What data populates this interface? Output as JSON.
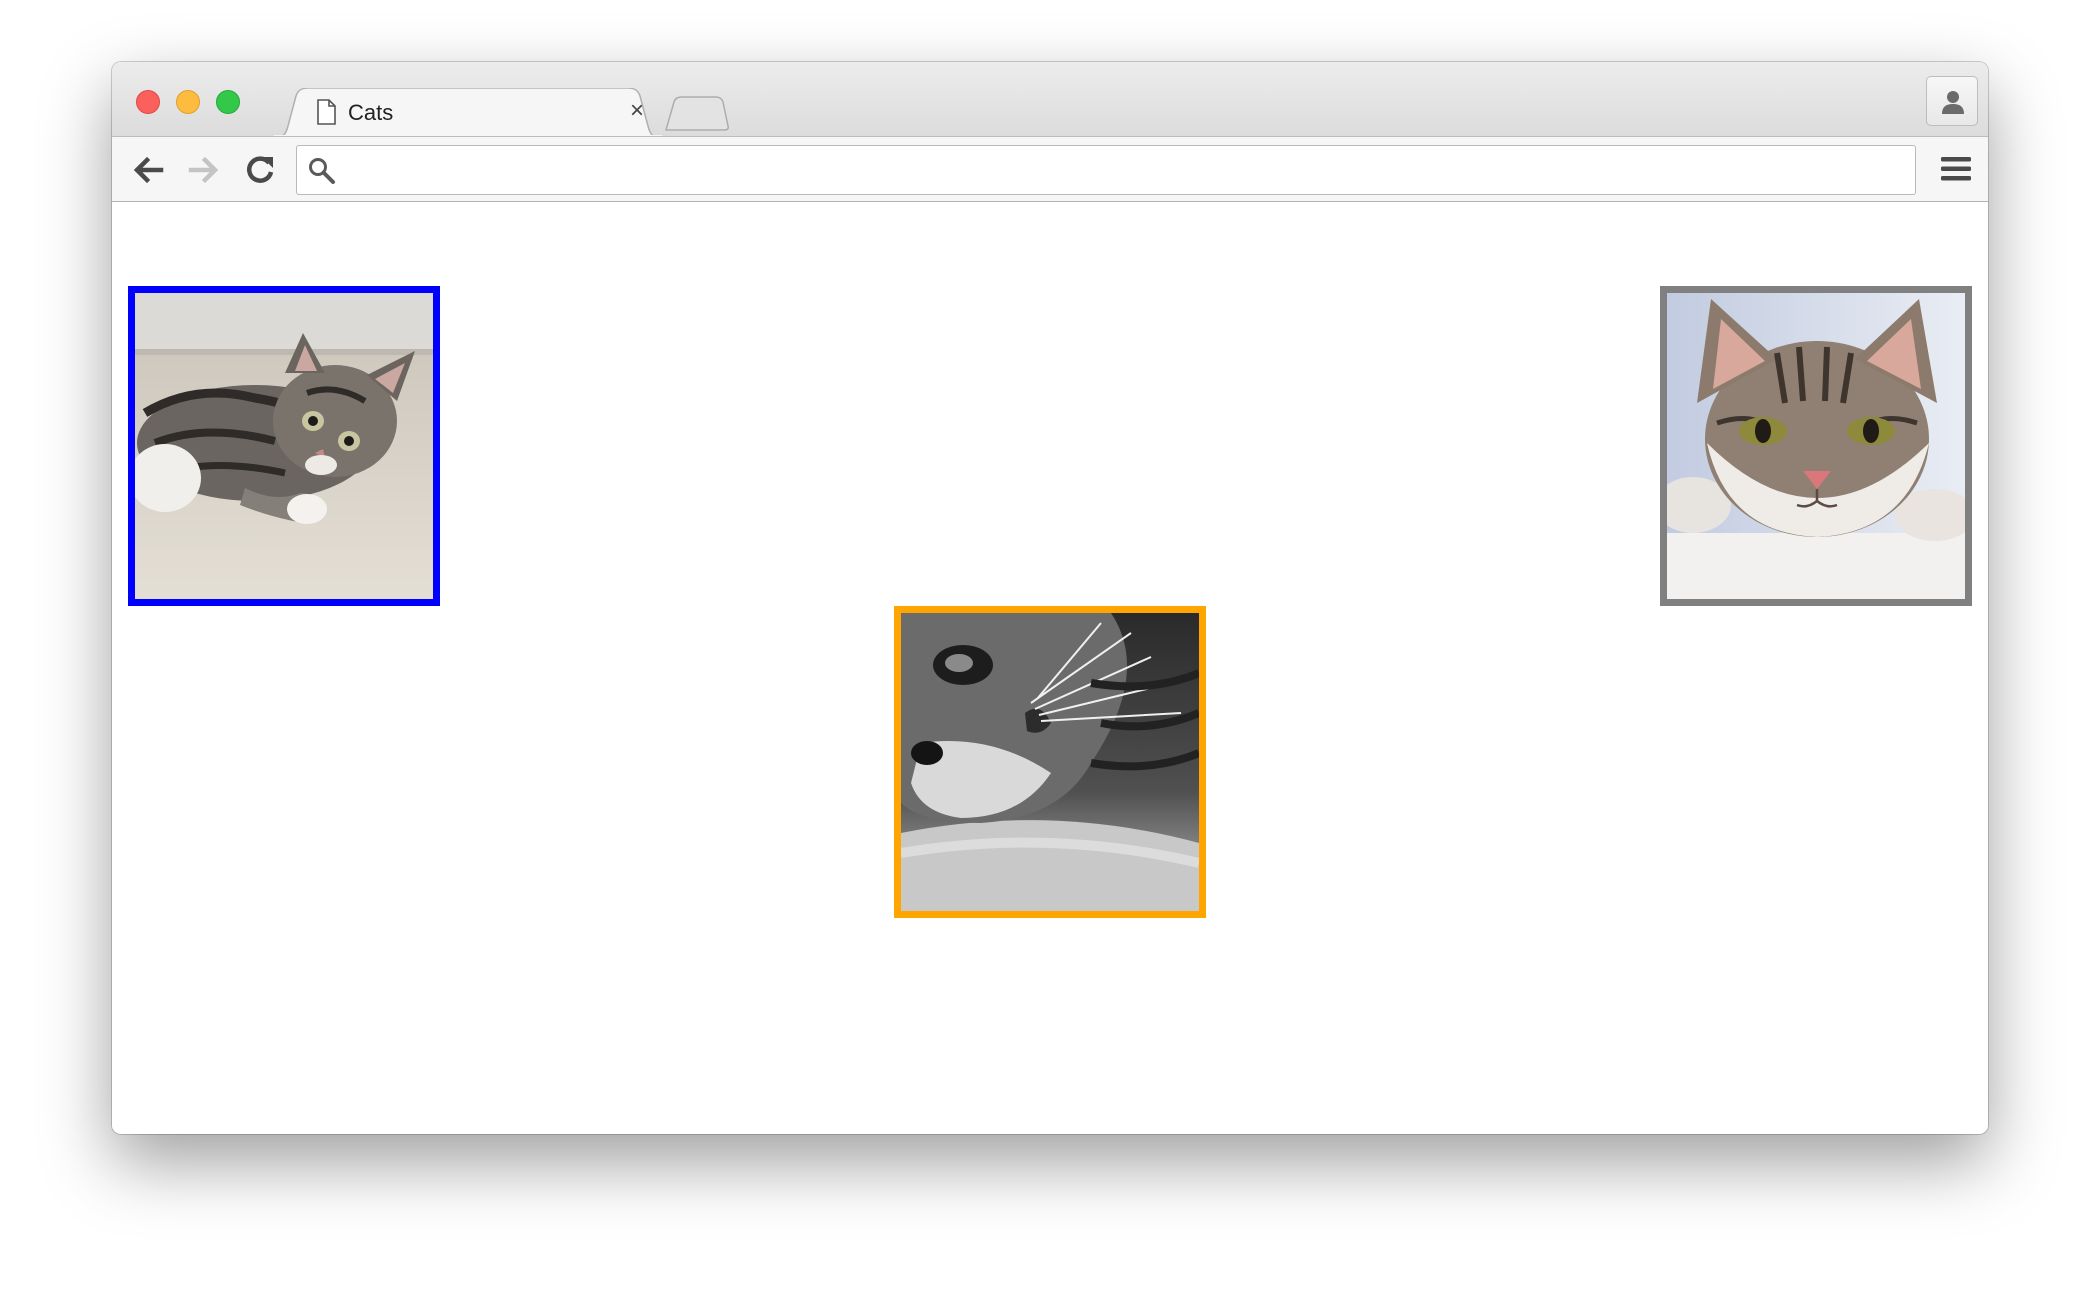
{
  "browser": {
    "tab": {
      "title": "Cats",
      "close_glyph": "×"
    },
    "omnibox": {
      "value": "",
      "placeholder": ""
    },
    "icons": {
      "back": "back-arrow-icon",
      "forward": "forward-arrow-icon",
      "reload": "reload-icon",
      "search": "search-icon",
      "menu": "hamburger-menu-icon",
      "profile": "person-icon",
      "tab_page": "document-icon"
    }
  },
  "page": {
    "images": [
      {
        "name": "cat-image-lying-kitten",
        "border_color": "#0000ff"
      },
      {
        "name": "cat-image-tabby-face",
        "border_color": "#808080"
      },
      {
        "name": "cat-image-black-white-closeup",
        "border_color": "#ffa500"
      }
    ]
  },
  "colors": {
    "traffic_close": "#fc605c",
    "traffic_minimize": "#fdbc40",
    "traffic_maximize": "#34c84a"
  }
}
